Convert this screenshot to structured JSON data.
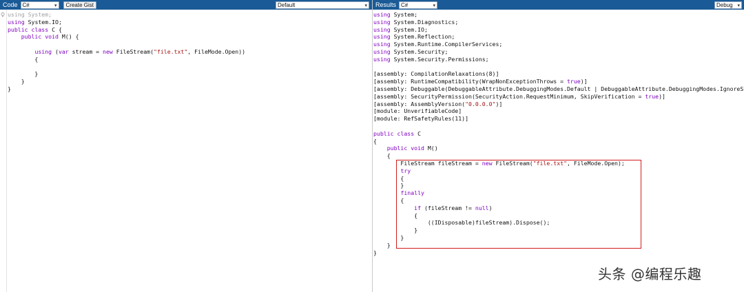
{
  "left_toolbar": {
    "code_label": "Code",
    "language": "C#",
    "create_gist_label": "Create Gist",
    "template": "Default"
  },
  "right_toolbar": {
    "results_label": "Results",
    "language": "C#",
    "mode": "Debug"
  },
  "editor_source": {
    "lines": [
      "using System;",
      "using System.IO;",
      "public class C {",
      "    public void M() {",
      "",
      "        using (var stream = new FileStream(\"file.txt\", FileMode.Open))",
      "        {",
      "",
      "        }",
      "    }",
      "}"
    ]
  },
  "results_output": {
    "lines": [
      "using System;",
      "using System.Diagnostics;",
      "using System.IO;",
      "using System.Reflection;",
      "using System.Runtime.CompilerServices;",
      "using System.Security;",
      "using System.Security.Permissions;",
      "",
      "[assembly: CompilationRelaxations(8)]",
      "[assembly: RuntimeCompatibility(WrapNonExceptionThrows = true)]",
      "[assembly: Debuggable(DebuggableAttribute.DebuggingModes.Default | DebuggableAttribute.DebuggingModes.IgnoreSymbolStoreSequencePoints)]",
      "[assembly: SecurityPermission(SecurityAction.RequestMinimum, SkipVerification = true)]",
      "[assembly: AssemblyVersion(\"0.0.0.0\")]",
      "[module: UnverifiableCode]",
      "[module: RefSafetyRules(11)]",
      "",
      "public class C",
      "{",
      "    public void M()",
      "    {",
      "        FileStream fileStream = new FileStream(\"file.txt\", FileMode.Open);",
      "        try",
      "        {",
      "        }",
      "        finally",
      "        {",
      "            if (fileStream != null)",
      "            {",
      "                ((IDisposable)fileStream).Dispose();",
      "            }",
      "        }",
      "    }",
      "}"
    ]
  },
  "watermark": {
    "text": "头条 @编程乐趣"
  },
  "colors": {
    "toolbar": "#1a5a96",
    "keyword": "#8000c0",
    "string": "#a31515",
    "highlight_border": "#d11a1a"
  },
  "icons": {
    "lightbulb": "lightbulb-icon",
    "dropdown": "chevron-down-icon"
  }
}
